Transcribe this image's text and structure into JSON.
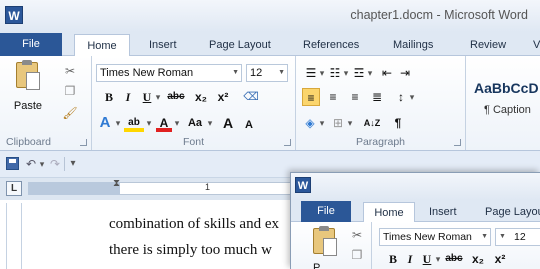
{
  "window": {
    "title": "chapter1.docm - Microsoft Word",
    "app_icon": "W"
  },
  "tabs": {
    "file": "File",
    "home": "Home",
    "insert": "Insert",
    "page_layout": "Page Layout",
    "references": "References",
    "mailings": "Mailings",
    "review": "Review",
    "view_partial": "V"
  },
  "font": {
    "name": "Times New Roman",
    "size": "12"
  },
  "clipboard": {
    "paste": "Paste",
    "label": "Clipboard"
  },
  "font_group": {
    "bold": "B",
    "italic": "I",
    "underline": "U",
    "strike": "abc",
    "subscript": "x₂",
    "superscript": "x²",
    "change_case": "Aa",
    "grow": "A",
    "shrink": "A",
    "label": "Font"
  },
  "paragraph": {
    "label": "Paragraph",
    "pilcrow": "¶",
    "sort": "A↓Z"
  },
  "styles": {
    "sample": "AaBbCcD",
    "caption": "¶ Caption"
  },
  "ruler": {
    "tab_selector": "L",
    "mark_1": "1"
  },
  "document": {
    "line1": "combination of skills and ex",
    "line2": "there is simply too much w"
  },
  "window2": {
    "app_icon": "W",
    "file": "File",
    "home": "Home",
    "insert": "Insert",
    "page_layout": "Page Layou",
    "font_name": "Times New Roman",
    "font_size": "12",
    "paste_partial": "P"
  },
  "colors": {
    "file_tab": "#2b5797",
    "highlight": "#ffd700",
    "font_color": "#e02020",
    "ribbon_bg": "#eef3f9"
  }
}
